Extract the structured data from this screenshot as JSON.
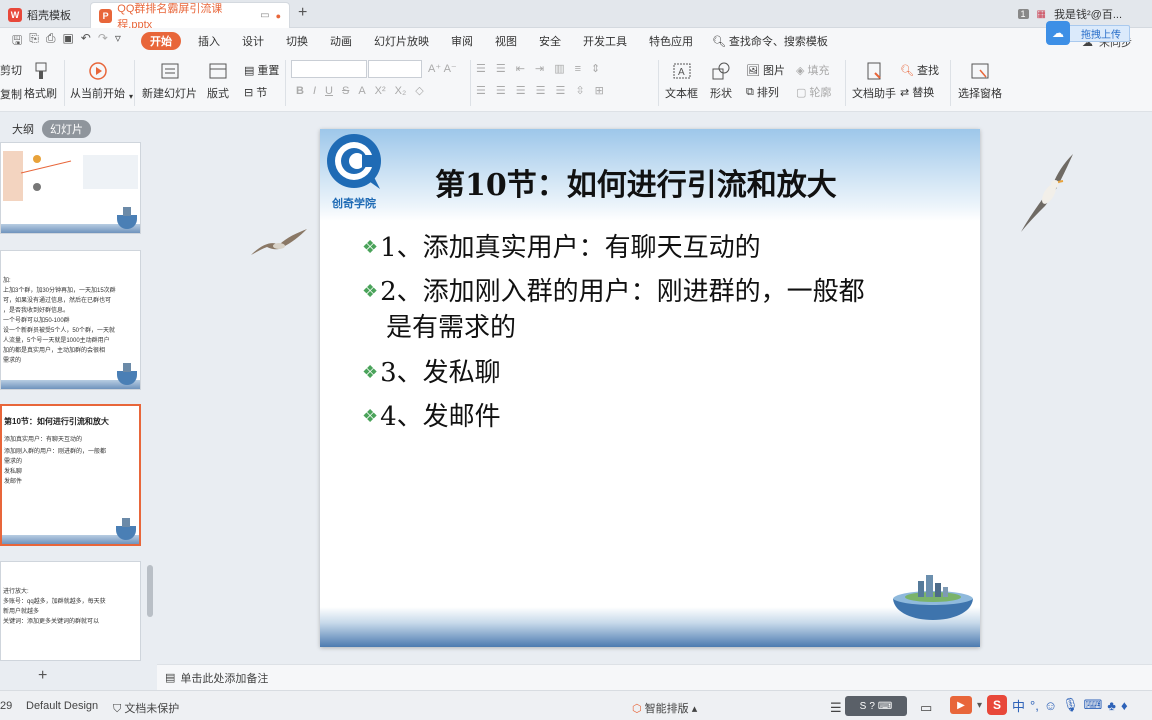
{
  "tabs": [
    {
      "label": "稻壳模板",
      "icon": "wps-icon"
    },
    {
      "label": "QQ群排名霸屏引流课程.pptx",
      "icon": "ppt-icon"
    }
  ],
  "titlebar": {
    "badge": "1",
    "user": "我是钱²@百..."
  },
  "menus": [
    "开始",
    "插入",
    "设计",
    "切换",
    "动画",
    "幻灯片放映",
    "审阅",
    "视图",
    "安全",
    "开发工具",
    "特色应用"
  ],
  "search_label": "查找命令、搜索模板",
  "menubar_right": {
    "sync": "未同步"
  },
  "upload_label": "拖拽上传",
  "ribbon": {
    "cut": "剪切",
    "copy": "复制",
    "format_painter": "格式刷",
    "from_current": "从当前开始",
    "new_slide": "新建幻灯片",
    "layout": "版式",
    "reset": "重置",
    "section": "节",
    "textbox": "文本框",
    "shape": "形状",
    "picture": "图片",
    "fill": "填充",
    "arrange": "排列",
    "outline": "轮廓",
    "doc_assistant": "文档助手",
    "find": "查找",
    "replace": "替换",
    "selection_pane": "选择窗格"
  },
  "panel_tabs": {
    "outline": "大纲",
    "slides": "幻灯片"
  },
  "thumbs": [
    {
      "lines": []
    },
    {
      "lines": [
        "加:",
        "上加3个群，加30分钟再加，一天加15次群",
        "可，如果没有通过信息，然后在已群也可",
        "，是否我收到好群信息。",
        "一个号群可以加50-100群",
        "设一个新群员被受5个人，50个群，一天就",
        "人流量，5个号一天就是1000主动群用户",
        "加的都是真实用户，主动加群的会很相",
        "需求的"
      ]
    },
    {
      "title": "第10节：如何进行引流和放大",
      "lines": [
        "添加真实用户：有聊天互动的",
        "添加刚入群的用户：刚进群的，一般都",
        "需求的",
        "发私聊",
        "发邮件"
      ]
    },
    {
      "lines": [
        "进行放大:",
        "多账号：qq越多，加群就越多，每天获",
        "新用户就越多",
        "关键词：添加更多关键词的群就可以"
      ]
    }
  ],
  "slide": {
    "logo_text": "创奇学院",
    "title": "第10节：如何进行引流和放大",
    "bullets": [
      "1、添加真实用户：有聊天互动的",
      "2、添加刚入群的用户：刚进群的，一般都",
      "是有需求的",
      "3、发私聊",
      "4、发邮件"
    ]
  },
  "notes_placeholder": "单击此处添加备注",
  "status": {
    "slide_num": "29",
    "theme": "Default Design",
    "protect": "文档未保护",
    "smart": "智能排版"
  },
  "colors": {
    "accent": "#e8663a",
    "bullet": "#4aa35a",
    "logo": "#1f6bb5"
  }
}
